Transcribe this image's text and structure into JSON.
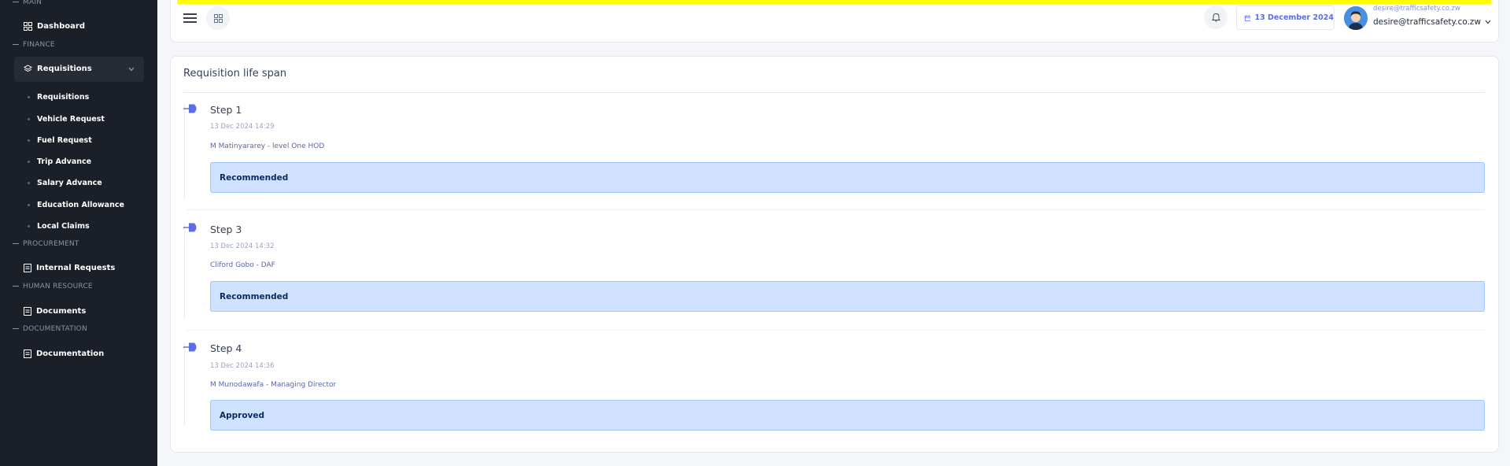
{
  "sidebar": {
    "sections": {
      "main": "MAIN",
      "finance": "FINANCE",
      "procurement": "PROCUREMENT",
      "human_resource": "HUMAN RESOURCE",
      "documentation": "DOCUMENTATION"
    },
    "dashboard": "Dashboard",
    "requisitions": "Requisitions",
    "sub_items": [
      "Requisitions",
      "Vehicle Request",
      "Fuel Request",
      "Trip Advance",
      "Salary Advance",
      "Education Allowance",
      "Local Claims"
    ],
    "internal_requests": "Internal Requests",
    "documents": "Documents",
    "documentation": "Documentation"
  },
  "header": {
    "date": "13 December 2024",
    "user_email_small": "desire@trafficsafety.co.zw",
    "user_email": "desire@trafficsafety.co.zw"
  },
  "main": {
    "title": "Requisition life span",
    "steps": [
      {
        "title": "Step 1",
        "time": "13 Dec 2024 14:29",
        "who": "M Matinyararey - level One HOD",
        "status": "Recommended"
      },
      {
        "title": "Step 3",
        "time": "13 Dec 2024 14:32",
        "who": "Cliford Gobo - DAF",
        "status": "Recommended"
      },
      {
        "title": "Step 4",
        "time": "13 Dec 2024 14:36",
        "who": "M Munodawafa - Managing Director",
        "status": "Approved"
      }
    ]
  },
  "colors": {
    "accent": "#5c6ee0",
    "sidebar_bg": "#1b1f27",
    "alert_bg": "#cfe2ff",
    "top_bar": "#ffff00"
  }
}
